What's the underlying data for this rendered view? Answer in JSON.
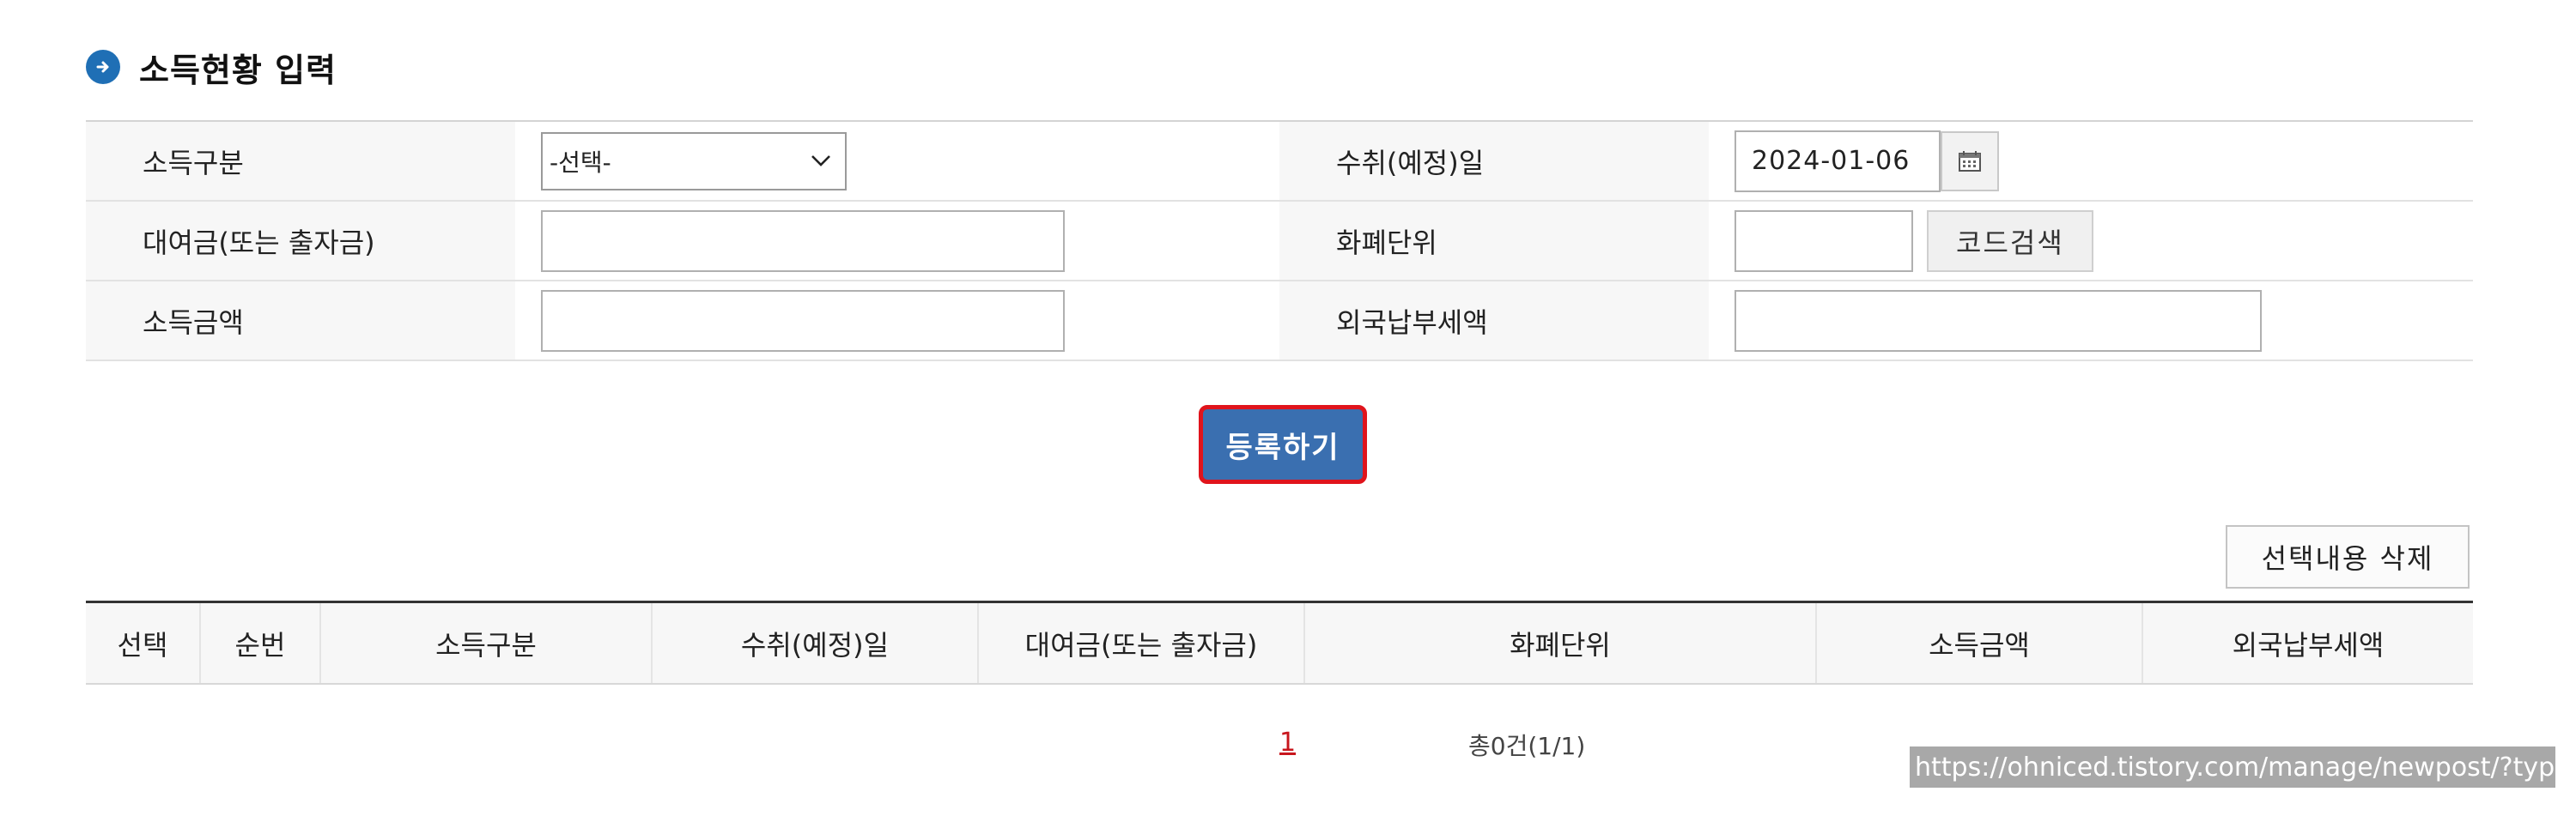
{
  "section": {
    "title": "소득현황 입력",
    "icon": "arrow-right-circle-icon",
    "accent": "#1f6fb5"
  },
  "form": {
    "income_type": {
      "label": "소득구분",
      "selected": "-선택-"
    },
    "receive_date": {
      "label": "수취(예정)일",
      "value": "2024-01-06"
    },
    "loan_amount": {
      "label": "대여금(또는 출자금)",
      "value": ""
    },
    "currency": {
      "label": "화폐단위",
      "value": "",
      "search_label": "코드검색"
    },
    "income_amount": {
      "label": "소득금액",
      "value": ""
    },
    "foreign_tax": {
      "label": "외국납부세액",
      "value": ""
    }
  },
  "actions": {
    "register_label": "등록하기",
    "delete_label": "선택내용 삭제"
  },
  "list": {
    "columns": [
      "선택",
      "순번",
      "소득구분",
      "수취(예정)일",
      "대여금(또는 출자금)",
      "화폐단위",
      "소득금액",
      "외국납부세액"
    ]
  },
  "pagination": {
    "current_page": "1",
    "total": "총0건(1/1)"
  },
  "overlay_url": "https://ohniced.tistory.com/manage/newpost/?type=p",
  "colors": {
    "register_bg": "#3a6fb0",
    "highlight_border": "#e0141c",
    "page_link": "#c8161d"
  }
}
